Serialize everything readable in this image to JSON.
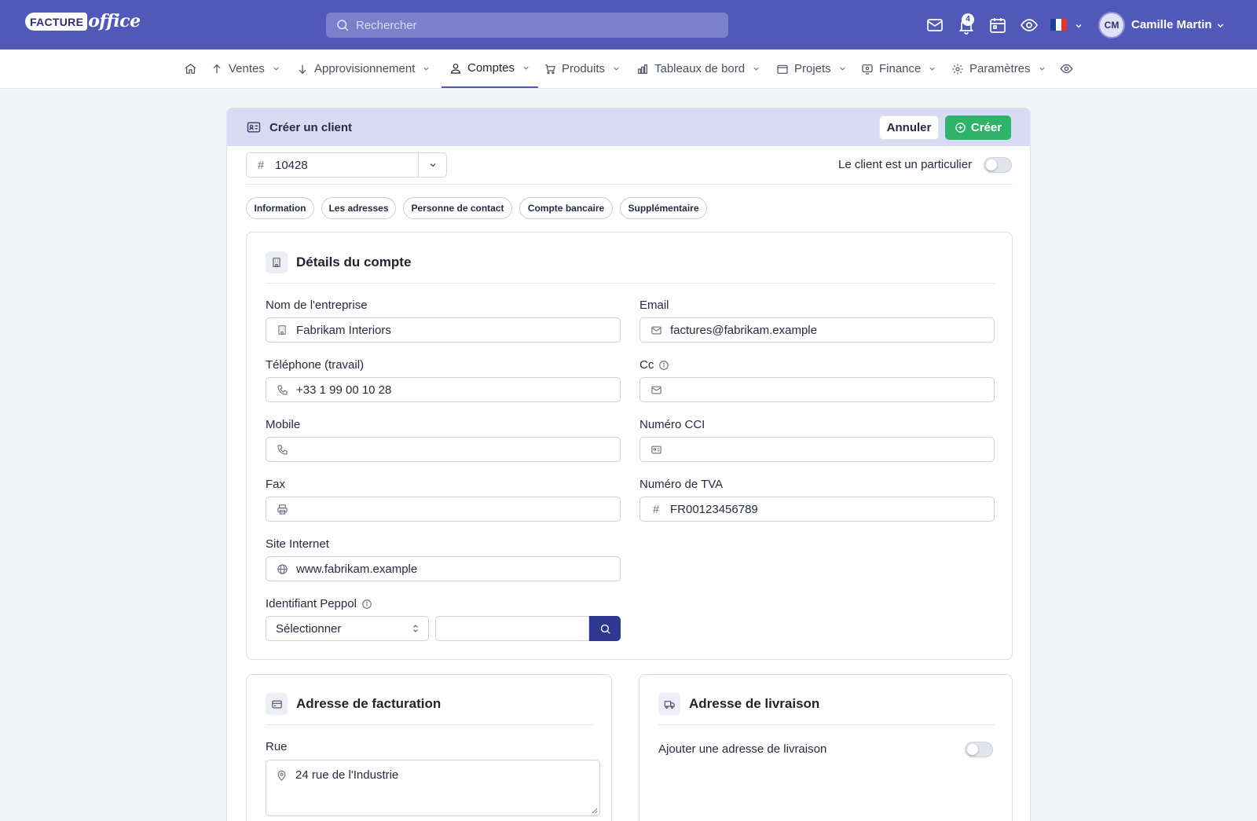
{
  "app": {
    "logo_word1": "FACTURE",
    "logo_word2": "office",
    "brand_color": "#5058b8",
    "accent_green": "#2fb36b"
  },
  "header": {
    "search_placeholder": "Rechercher",
    "notification_count": "4",
    "language": "FR",
    "user_initials": "CM",
    "user_name": "Camille Martin"
  },
  "nav": {
    "home": "home-icon",
    "items": [
      {
        "label": "Ventes",
        "icon": "arrow-up-icon"
      },
      {
        "label": "Approvisionnement",
        "icon": "arrow-down-icon"
      },
      {
        "label": "Comptes",
        "icon": "user-icon",
        "active": true
      },
      {
        "label": "Produits",
        "icon": "cart-icon"
      },
      {
        "label": "Tableaux de bord",
        "icon": "bar-chart-icon"
      },
      {
        "label": "Projets",
        "icon": "folder-icon"
      },
      {
        "label": "Finance",
        "icon": "monitor-icon"
      },
      {
        "label": "Paramètres",
        "icon": "gear-icon"
      }
    ]
  },
  "form": {
    "title": "Créer un client",
    "cancel_label": "Annuler",
    "create_label": "Créer",
    "client_number": "10428",
    "particulier_label": "Le client est un particulier",
    "particulier_on": false,
    "tabs": [
      "Information",
      "Les adresses",
      "Personne de contact",
      "Compte bancaire",
      "Supplémentaire"
    ]
  },
  "account": {
    "title": "Détails du compte",
    "company_label": "Nom de l'entreprise",
    "company_value": "Fabrikam Interiors",
    "email_label": "Email",
    "email_value": "factures@fabrikam.example",
    "phone_label": "Téléphone (travail)",
    "phone_value": "+33 1 99 00 10 28",
    "cc_label": "Cc",
    "cc_value": "",
    "mobile_label": "Mobile",
    "mobile_value": "",
    "cci_label": "Numéro CCI",
    "cci_value": "",
    "fax_label": "Fax",
    "fax_value": "",
    "tva_label": "Numéro de TVA",
    "tva_value": "FR00123456789",
    "website_label": "Site Internet",
    "website_value": "www.fabrikam.example",
    "peppol_label": "Identifiant Peppol",
    "peppol_select": "Sélectionner",
    "peppol_value": ""
  },
  "billing": {
    "title": "Adresse de facturation",
    "street_label": "Rue",
    "street_value": "24 rue de l'Industrie"
  },
  "shipping": {
    "title": "Adresse de livraison",
    "add_label": "Ajouter une adresse de livraison",
    "add_on": false
  }
}
